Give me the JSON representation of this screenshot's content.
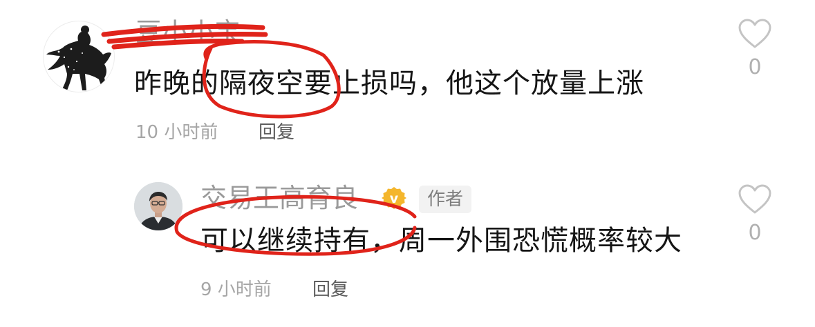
{
  "comments": [
    {
      "username": "豆小小宝",
      "text": "昨晚的隔夜空要止损吗，他这个放量上涨",
      "time": "10 小时前",
      "reply_label": "回复",
      "like_count": "0"
    },
    {
      "username": "交易王高育良",
      "verified_badge": "v",
      "author_tag": "作者",
      "text": "可以继续持有，周一外围恐慌概率较大",
      "time": "9 小时前",
      "reply_label": "回复",
      "like_count": "0"
    }
  ],
  "icons": {
    "like": "heart-outline-icon",
    "verified": "verified-badge-icon"
  },
  "colors": {
    "annotation_red": "#e0231a",
    "badge_gold": "#f4b62c",
    "meta_gray": "#a6a6a6",
    "heart_gray": "#c4c4c4"
  }
}
